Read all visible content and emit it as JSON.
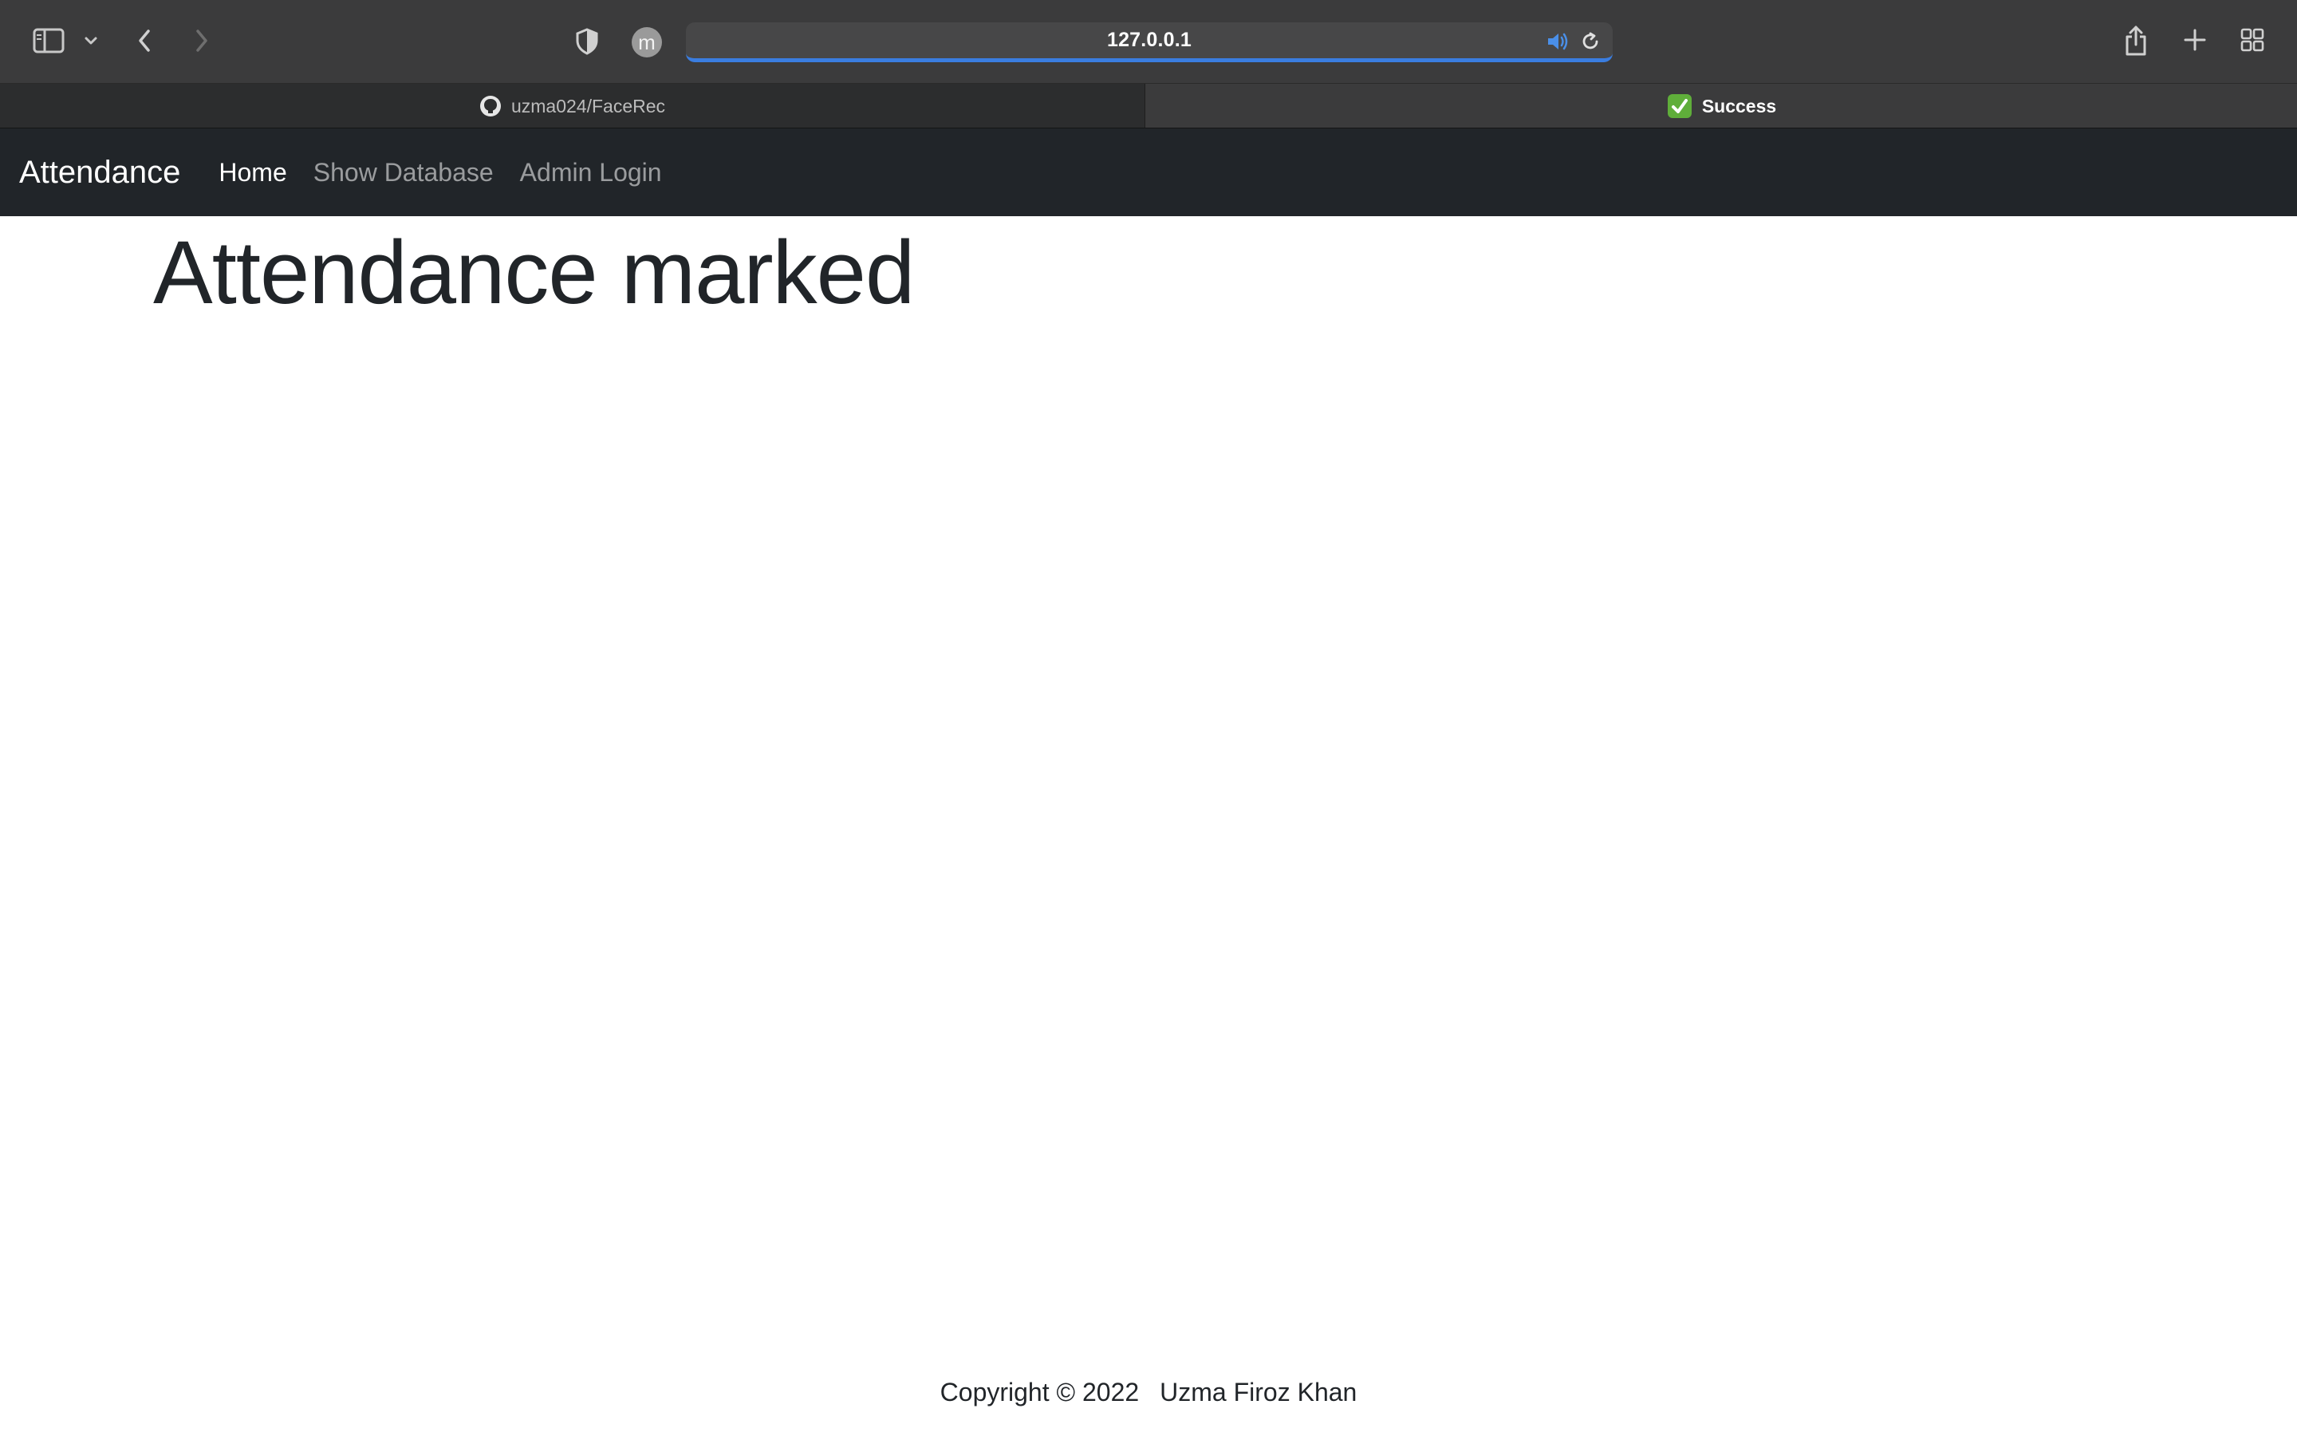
{
  "browser": {
    "address": "127.0.0.1",
    "profile_initial": "m",
    "icons": {
      "sidebar": "sidebar-icon",
      "sidebar_menu": "chevron-down-icon",
      "back": "back-arrow-icon",
      "forward": "forward-arrow-icon",
      "privacy": "shield-icon",
      "audio": "speaker-icon",
      "reload": "reload-icon",
      "share": "share-icon",
      "new_tab": "plus-icon",
      "tab_overview": "grid-icon"
    },
    "tabs": [
      {
        "label": "uzma024/FaceRec",
        "icon": "github-icon",
        "active": false
      },
      {
        "label": "Success",
        "icon": "checkmark-icon",
        "active": true
      }
    ]
  },
  "navbar": {
    "brand": "Attendance",
    "links": [
      {
        "label": "Home",
        "active": true
      },
      {
        "label": "Show Database",
        "active": false
      },
      {
        "label": "Admin Login",
        "active": false
      }
    ]
  },
  "main": {
    "heading": "Attendance marked"
  },
  "footer": {
    "copyright": "Copyright © 2022",
    "author": "Uzma Firoz Khan"
  },
  "colors": {
    "navbar_bg": "#212529",
    "chrome_bg": "#3b3b3c",
    "accent": "#3a7de0",
    "check_green": "#5fae3a"
  }
}
